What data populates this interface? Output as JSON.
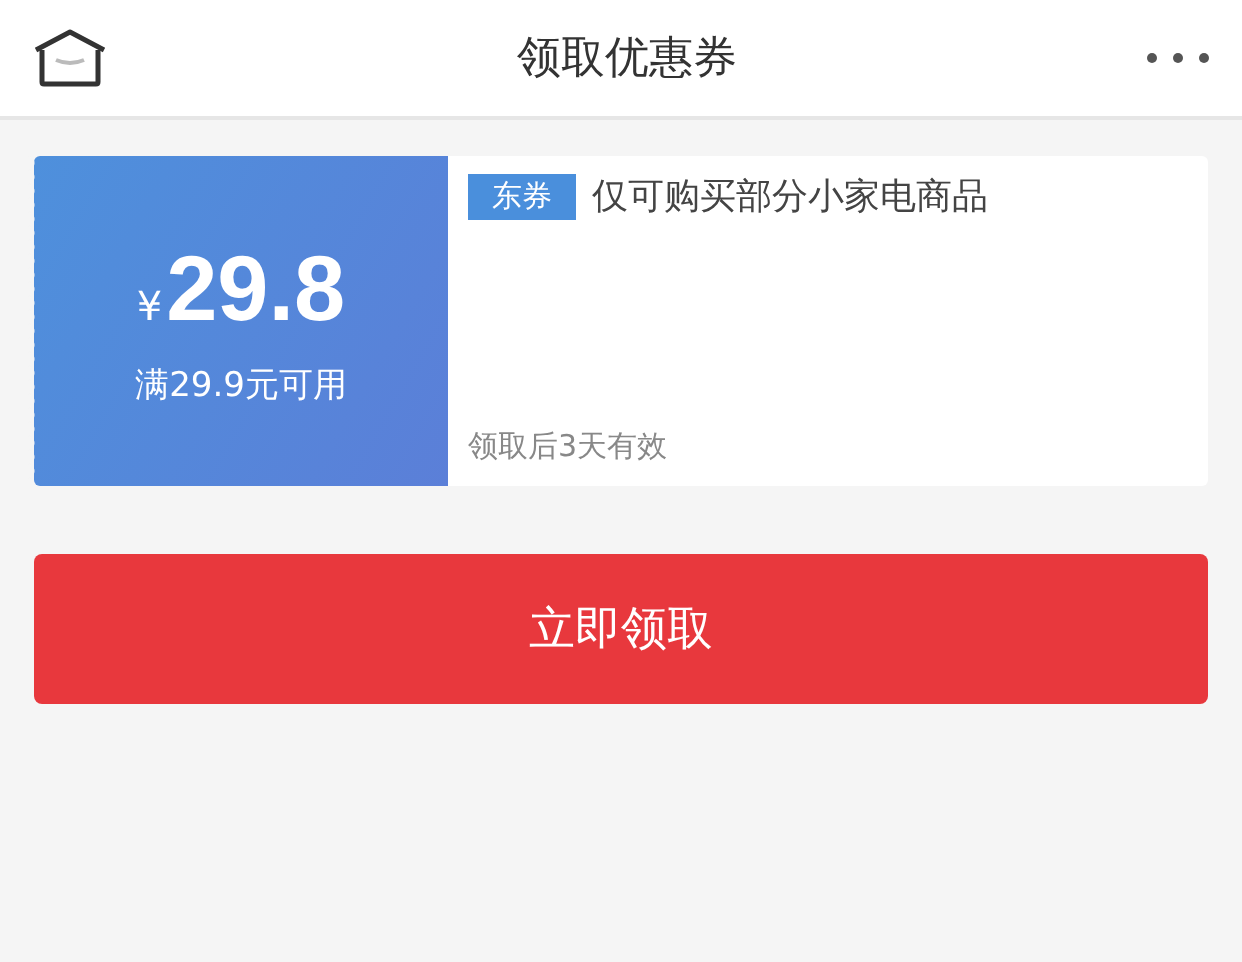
{
  "header": {
    "title": "领取优惠券"
  },
  "coupon": {
    "currency": "¥",
    "amount": "29.8",
    "condition": "满29.9元可用",
    "tag": "东券",
    "description": "仅可购买部分小家电商品",
    "validity": "领取后3天有效"
  },
  "action_button": {
    "label": "立即领取"
  }
}
